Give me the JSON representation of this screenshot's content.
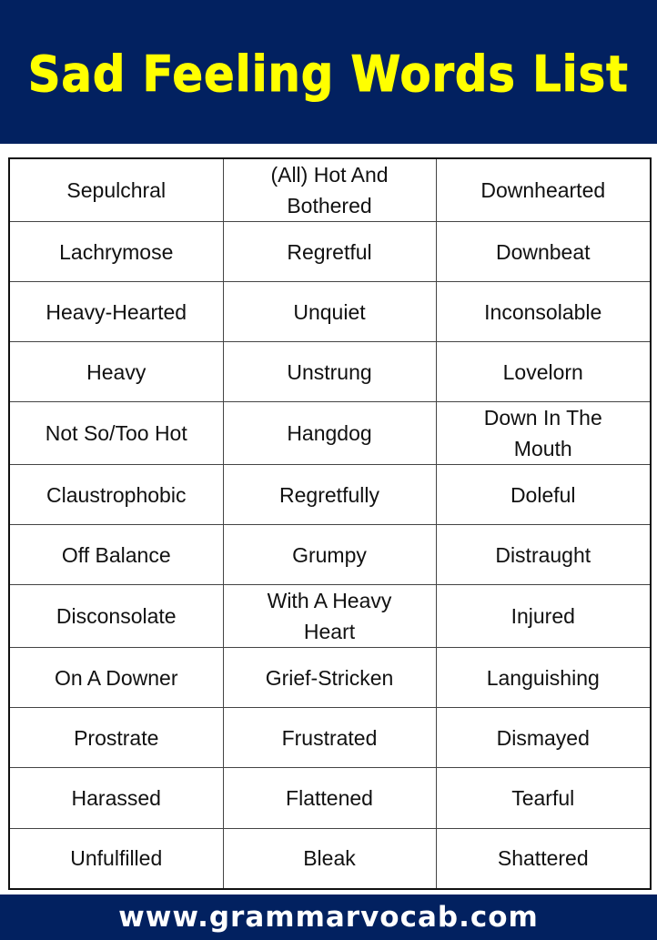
{
  "header": {
    "title": "Sad Feeling Words List",
    "background_color": "#022160",
    "title_color": "#ffff00"
  },
  "table": {
    "rows": [
      [
        "Sepulchral",
        "(All) Hot And Bothered",
        "Downhearted"
      ],
      [
        "Lachrymose",
        "Regretful",
        "Downbeat"
      ],
      [
        "Heavy-Hearted",
        "Unquiet",
        "Inconsolable"
      ],
      [
        "Heavy",
        "Unstrung",
        "Lovelorn"
      ],
      [
        "Not So/Too Hot",
        "Hangdog",
        "Down In The Mouth"
      ],
      [
        "Claustrophobic",
        "Regretfully",
        "Doleful"
      ],
      [
        "Off Balance",
        "Grumpy",
        "Distraught"
      ],
      [
        "Disconsolate",
        "With A Heavy Heart",
        "Injured"
      ],
      [
        "On A Downer",
        "Grief-Stricken",
        "Languishing"
      ],
      [
        "Prostrate",
        "Frustrated",
        "Dismayed"
      ],
      [
        "Harassed",
        "Flattened",
        "Tearful"
      ],
      [
        "Unfulfilled",
        "Bleak",
        "Shattered"
      ]
    ]
  },
  "footer": {
    "url": "www.grammarvocab.com",
    "background_color": "#022160",
    "text_color": "#ffffff"
  }
}
